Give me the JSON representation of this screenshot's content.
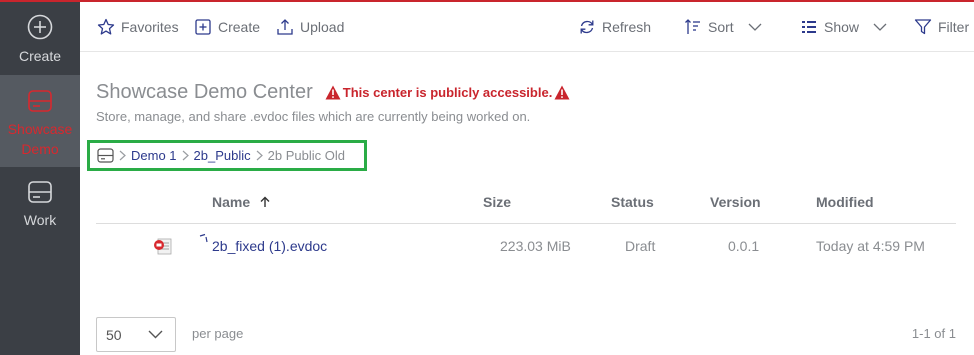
{
  "rail": {
    "create_label": "Create",
    "showcase_label": "Showcase Demo",
    "work_label": "Work"
  },
  "toolbar": {
    "favorites": "Favorites",
    "create": "Create",
    "upload": "Upload",
    "refresh": "Refresh",
    "sort": "Sort",
    "show": "Show",
    "filter": "Filter"
  },
  "header": {
    "title": "Showcase Demo Center",
    "warning": "This center is publicly accessible.",
    "subtitle": "Store, manage, and share .evdoc files which are currently being worked on."
  },
  "breadcrumb": {
    "items": [
      "Demo 1",
      "2b_Public"
    ],
    "current": "2b Public Old"
  },
  "table": {
    "columns": {
      "name": "Name",
      "size": "Size",
      "status": "Status",
      "version": "Version",
      "modified": "Modified"
    },
    "rows": [
      {
        "name": "2b_fixed (1).evdoc",
        "size": "223.03 MiB",
        "status": "Draft",
        "version": "0.0.1",
        "modified": "Today at 4:59 PM"
      }
    ]
  },
  "pagination": {
    "page_size": "50",
    "per_page_label": "per page",
    "range": "1-1 of 1"
  },
  "colors": {
    "accent_red": "#c9252d",
    "rail_bg": "#3b3f45",
    "link_blue": "#2d3a8c",
    "highlight_green": "#2aac46"
  }
}
